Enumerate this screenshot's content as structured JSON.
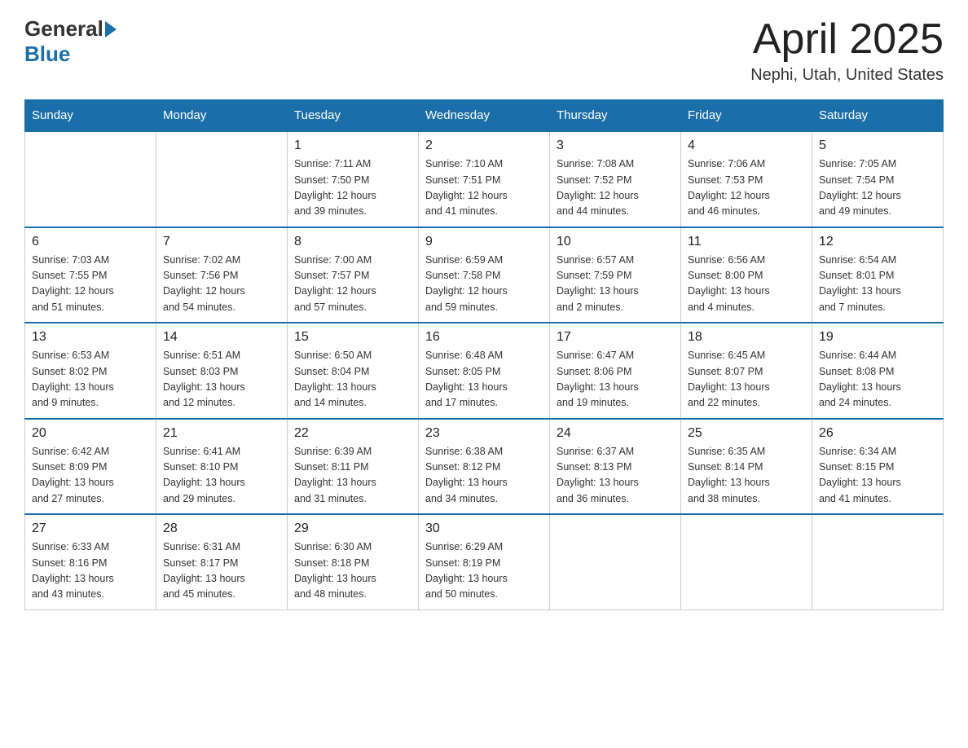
{
  "logo": {
    "general": "General",
    "blue": "Blue"
  },
  "title": "April 2025",
  "subtitle": "Nephi, Utah, United States",
  "days_of_week": [
    "Sunday",
    "Monday",
    "Tuesday",
    "Wednesday",
    "Thursday",
    "Friday",
    "Saturday"
  ],
  "weeks": [
    [
      {
        "day": "",
        "info": ""
      },
      {
        "day": "",
        "info": ""
      },
      {
        "day": "1",
        "info": "Sunrise: 7:11 AM\nSunset: 7:50 PM\nDaylight: 12 hours\nand 39 minutes."
      },
      {
        "day": "2",
        "info": "Sunrise: 7:10 AM\nSunset: 7:51 PM\nDaylight: 12 hours\nand 41 minutes."
      },
      {
        "day": "3",
        "info": "Sunrise: 7:08 AM\nSunset: 7:52 PM\nDaylight: 12 hours\nand 44 minutes."
      },
      {
        "day": "4",
        "info": "Sunrise: 7:06 AM\nSunset: 7:53 PM\nDaylight: 12 hours\nand 46 minutes."
      },
      {
        "day": "5",
        "info": "Sunrise: 7:05 AM\nSunset: 7:54 PM\nDaylight: 12 hours\nand 49 minutes."
      }
    ],
    [
      {
        "day": "6",
        "info": "Sunrise: 7:03 AM\nSunset: 7:55 PM\nDaylight: 12 hours\nand 51 minutes."
      },
      {
        "day": "7",
        "info": "Sunrise: 7:02 AM\nSunset: 7:56 PM\nDaylight: 12 hours\nand 54 minutes."
      },
      {
        "day": "8",
        "info": "Sunrise: 7:00 AM\nSunset: 7:57 PM\nDaylight: 12 hours\nand 57 minutes."
      },
      {
        "day": "9",
        "info": "Sunrise: 6:59 AM\nSunset: 7:58 PM\nDaylight: 12 hours\nand 59 minutes."
      },
      {
        "day": "10",
        "info": "Sunrise: 6:57 AM\nSunset: 7:59 PM\nDaylight: 13 hours\nand 2 minutes."
      },
      {
        "day": "11",
        "info": "Sunrise: 6:56 AM\nSunset: 8:00 PM\nDaylight: 13 hours\nand 4 minutes."
      },
      {
        "day": "12",
        "info": "Sunrise: 6:54 AM\nSunset: 8:01 PM\nDaylight: 13 hours\nand 7 minutes."
      }
    ],
    [
      {
        "day": "13",
        "info": "Sunrise: 6:53 AM\nSunset: 8:02 PM\nDaylight: 13 hours\nand 9 minutes."
      },
      {
        "day": "14",
        "info": "Sunrise: 6:51 AM\nSunset: 8:03 PM\nDaylight: 13 hours\nand 12 minutes."
      },
      {
        "day": "15",
        "info": "Sunrise: 6:50 AM\nSunset: 8:04 PM\nDaylight: 13 hours\nand 14 minutes."
      },
      {
        "day": "16",
        "info": "Sunrise: 6:48 AM\nSunset: 8:05 PM\nDaylight: 13 hours\nand 17 minutes."
      },
      {
        "day": "17",
        "info": "Sunrise: 6:47 AM\nSunset: 8:06 PM\nDaylight: 13 hours\nand 19 minutes."
      },
      {
        "day": "18",
        "info": "Sunrise: 6:45 AM\nSunset: 8:07 PM\nDaylight: 13 hours\nand 22 minutes."
      },
      {
        "day": "19",
        "info": "Sunrise: 6:44 AM\nSunset: 8:08 PM\nDaylight: 13 hours\nand 24 minutes."
      }
    ],
    [
      {
        "day": "20",
        "info": "Sunrise: 6:42 AM\nSunset: 8:09 PM\nDaylight: 13 hours\nand 27 minutes."
      },
      {
        "day": "21",
        "info": "Sunrise: 6:41 AM\nSunset: 8:10 PM\nDaylight: 13 hours\nand 29 minutes."
      },
      {
        "day": "22",
        "info": "Sunrise: 6:39 AM\nSunset: 8:11 PM\nDaylight: 13 hours\nand 31 minutes."
      },
      {
        "day": "23",
        "info": "Sunrise: 6:38 AM\nSunset: 8:12 PM\nDaylight: 13 hours\nand 34 minutes."
      },
      {
        "day": "24",
        "info": "Sunrise: 6:37 AM\nSunset: 8:13 PM\nDaylight: 13 hours\nand 36 minutes."
      },
      {
        "day": "25",
        "info": "Sunrise: 6:35 AM\nSunset: 8:14 PM\nDaylight: 13 hours\nand 38 minutes."
      },
      {
        "day": "26",
        "info": "Sunrise: 6:34 AM\nSunset: 8:15 PM\nDaylight: 13 hours\nand 41 minutes."
      }
    ],
    [
      {
        "day": "27",
        "info": "Sunrise: 6:33 AM\nSunset: 8:16 PM\nDaylight: 13 hours\nand 43 minutes."
      },
      {
        "day": "28",
        "info": "Sunrise: 6:31 AM\nSunset: 8:17 PM\nDaylight: 13 hours\nand 45 minutes."
      },
      {
        "day": "29",
        "info": "Sunrise: 6:30 AM\nSunset: 8:18 PM\nDaylight: 13 hours\nand 48 minutes."
      },
      {
        "day": "30",
        "info": "Sunrise: 6:29 AM\nSunset: 8:19 PM\nDaylight: 13 hours\nand 50 minutes."
      },
      {
        "day": "",
        "info": ""
      },
      {
        "day": "",
        "info": ""
      },
      {
        "day": "",
        "info": ""
      }
    ]
  ]
}
